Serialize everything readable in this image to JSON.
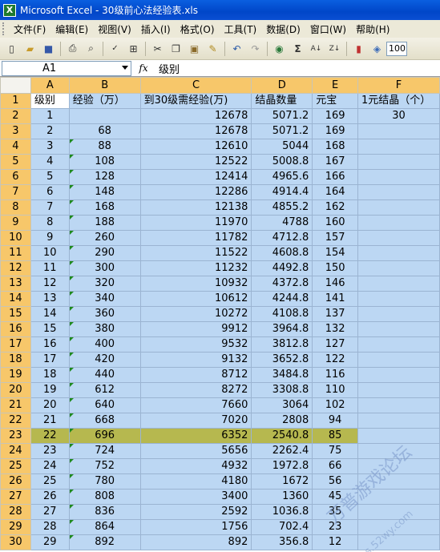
{
  "window": {
    "title": "Microsoft Excel - 30级前心法经验表.xls",
    "app_icon": "X"
  },
  "menu": [
    "文件(F)",
    "编辑(E)",
    "视图(V)",
    "插入(I)",
    "格式(O)",
    "工具(T)",
    "数据(D)",
    "窗口(W)",
    "帮助(H)"
  ],
  "toolbar": {
    "zoom": "100"
  },
  "formula_bar": {
    "name_box": "A1",
    "fx_label": "fx",
    "content": "级别"
  },
  "columns": [
    "A",
    "B",
    "C",
    "D",
    "E",
    "F"
  ],
  "header_row": [
    "级别",
    "经验（万）",
    "到30级需经验(万)",
    "结晶数量",
    "元宝",
    "1元结晶（个）"
  ],
  "rows": [
    {
      "n": "2",
      "a": "1",
      "b": "",
      "c": "12678",
      "d": "5071.2",
      "e": "169",
      "f": "30"
    },
    {
      "n": "3",
      "a": "2",
      "b": "68",
      "c": "12678",
      "d": "5071.2",
      "e": "169",
      "f": ""
    },
    {
      "n": "4",
      "a": "3",
      "b": "88",
      "c": "12610",
      "d": "5044",
      "e": "168",
      "f": ""
    },
    {
      "n": "5",
      "a": "4",
      "b": "108",
      "c": "12522",
      "d": "5008.8",
      "e": "167",
      "f": ""
    },
    {
      "n": "6",
      "a": "5",
      "b": "128",
      "c": "12414",
      "d": "4965.6",
      "e": "166",
      "f": ""
    },
    {
      "n": "7",
      "a": "6",
      "b": "148",
      "c": "12286",
      "d": "4914.4",
      "e": "164",
      "f": ""
    },
    {
      "n": "8",
      "a": "7",
      "b": "168",
      "c": "12138",
      "d": "4855.2",
      "e": "162",
      "f": ""
    },
    {
      "n": "9",
      "a": "8",
      "b": "188",
      "c": "11970",
      "d": "4788",
      "e": "160",
      "f": ""
    },
    {
      "n": "10",
      "a": "9",
      "b": "260",
      "c": "11782",
      "d": "4712.8",
      "e": "157",
      "f": ""
    },
    {
      "n": "11",
      "a": "10",
      "b": "290",
      "c": "11522",
      "d": "4608.8",
      "e": "154",
      "f": ""
    },
    {
      "n": "12",
      "a": "11",
      "b": "300",
      "c": "11232",
      "d": "4492.8",
      "e": "150",
      "f": ""
    },
    {
      "n": "13",
      "a": "12",
      "b": "320",
      "c": "10932",
      "d": "4372.8",
      "e": "146",
      "f": ""
    },
    {
      "n": "14",
      "a": "13",
      "b": "340",
      "c": "10612",
      "d": "4244.8",
      "e": "141",
      "f": ""
    },
    {
      "n": "15",
      "a": "14",
      "b": "360",
      "c": "10272",
      "d": "4108.8",
      "e": "137",
      "f": ""
    },
    {
      "n": "16",
      "a": "15",
      "b": "380",
      "c": "9912",
      "d": "3964.8",
      "e": "132",
      "f": ""
    },
    {
      "n": "17",
      "a": "16",
      "b": "400",
      "c": "9532",
      "d": "3812.8",
      "e": "127",
      "f": ""
    },
    {
      "n": "18",
      "a": "17",
      "b": "420",
      "c": "9132",
      "d": "3652.8",
      "e": "122",
      "f": ""
    },
    {
      "n": "19",
      "a": "18",
      "b": "440",
      "c": "8712",
      "d": "3484.8",
      "e": "116",
      "f": ""
    },
    {
      "n": "20",
      "a": "19",
      "b": "612",
      "c": "8272",
      "d": "3308.8",
      "e": "110",
      "f": ""
    },
    {
      "n": "21",
      "a": "20",
      "b": "640",
      "c": "7660",
      "d": "3064",
      "e": "102",
      "f": ""
    },
    {
      "n": "22",
      "a": "21",
      "b": "668",
      "c": "7020",
      "d": "2808",
      "e": "94",
      "f": ""
    },
    {
      "n": "23",
      "a": "22",
      "b": "696",
      "c": "6352",
      "d": "2540.8",
      "e": "85",
      "f": ""
    },
    {
      "n": "24",
      "a": "23",
      "b": "724",
      "c": "5656",
      "d": "2262.4",
      "e": "75",
      "f": ""
    },
    {
      "n": "25",
      "a": "24",
      "b": "752",
      "c": "4932",
      "d": "1972.8",
      "e": "66",
      "f": ""
    },
    {
      "n": "26",
      "a": "25",
      "b": "780",
      "c": "4180",
      "d": "1672",
      "e": "56",
      "f": ""
    },
    {
      "n": "27",
      "a": "26",
      "b": "808",
      "c": "3400",
      "d": "1360",
      "e": "45",
      "f": ""
    },
    {
      "n": "28",
      "a": "27",
      "b": "836",
      "c": "2592",
      "d": "1036.8",
      "e": "35",
      "f": ""
    },
    {
      "n": "29",
      "a": "28",
      "b": "864",
      "c": "1756",
      "d": "702.4",
      "e": "23",
      "f": ""
    },
    {
      "n": "30",
      "a": "29",
      "b": "892",
      "c": "892",
      "d": "356.8",
      "e": "12",
      "f": ""
    }
  ],
  "highlight_row": "23",
  "watermark": {
    "text": "万普游戏论坛",
    "url": "bbs.52wy.com"
  },
  "colors": {
    "selection_blue": "#bcd7f3",
    "highlight_olive": "#b6b84f",
    "header_selected": "#f7c76a"
  }
}
